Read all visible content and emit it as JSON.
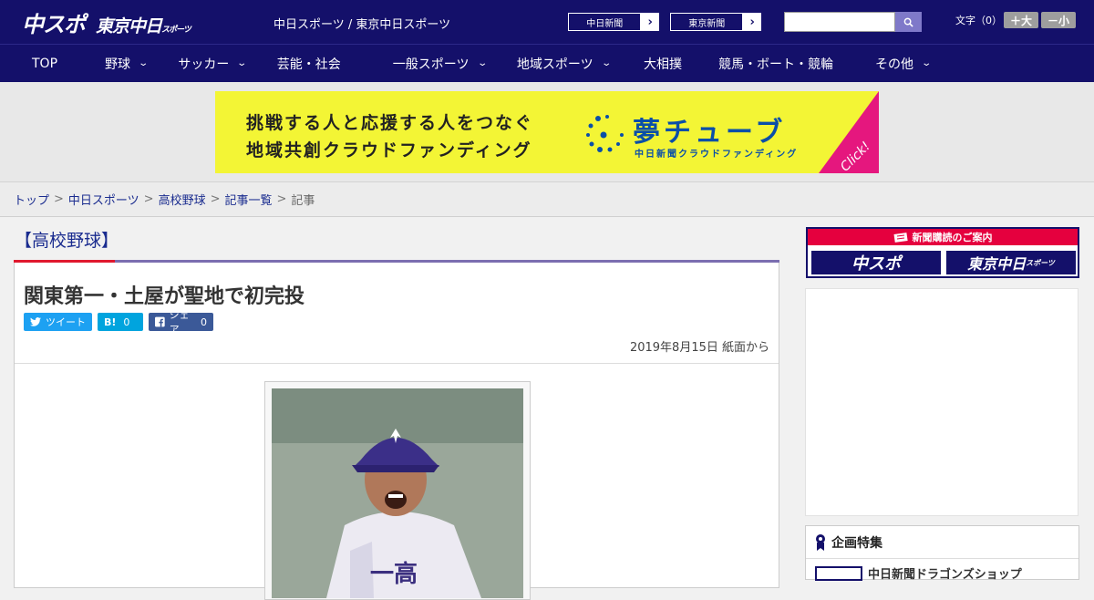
{
  "header": {
    "logo_main": "中スポ",
    "logo_tokyo": "東京中日",
    "logo_tokyo_suffix": "スポーツ",
    "site_title": "中日スポーツ / 東京中日スポーツ",
    "paper_links": [
      {
        "label": "中日新聞"
      },
      {
        "label": "東京新聞"
      }
    ],
    "search": {
      "placeholder": "",
      "value": ""
    },
    "font_size_label": "文字（0）",
    "font_bigger": "＋大",
    "font_smaller": "－小"
  },
  "nav": {
    "items": [
      {
        "label": "TOP",
        "has_dropdown": false
      },
      {
        "label": "野球",
        "has_dropdown": true
      },
      {
        "label": "サッカー",
        "has_dropdown": true
      },
      {
        "label": "芸能・社会",
        "has_dropdown": false
      },
      {
        "label": "一般スポーツ",
        "has_dropdown": true
      },
      {
        "label": "地域スポーツ",
        "has_dropdown": true
      },
      {
        "label": "大相撲",
        "has_dropdown": false
      },
      {
        "label": "競馬・ボート・競輪",
        "has_dropdown": false
      },
      {
        "label": "その他",
        "has_dropdown": true
      }
    ]
  },
  "banner": {
    "line1": "挑戦する人と応援する人をつなぐ",
    "line2": "地域共創クラウドファンディング",
    "brand": "夢チューブ",
    "brand_sub": "中日新聞クラウドファンディング",
    "click": "Click!"
  },
  "breadcrumb": {
    "items": [
      "トップ",
      "中日スポーツ",
      "高校野球",
      "記事一覧"
    ],
    "current": "記事",
    "separator": ">"
  },
  "article": {
    "category": "【高校野球】",
    "headline": "関東第一・土屋が聖地で初完投",
    "share": {
      "twitter": "ツイート",
      "hatena_label": "B!",
      "hatena_count": "0",
      "facebook": "シェア",
      "facebook_count": "0"
    },
    "date": "2019年8月15日 紙面から"
  },
  "sidebar": {
    "subscription_title": "新聞購読のご案内",
    "sub_chuspo": "中スポ",
    "sub_tokyo": "東京中日",
    "sub_tokyo_suffix": "スポーツ",
    "feature_title": "企画特集",
    "feature_item": "中日新聞ドラゴンズショップ"
  },
  "colors": {
    "brand_navy": "#14106a",
    "accent_red": "#e0182e",
    "banner_yellow": "#f3f535",
    "link_blue": "#1a2c8f"
  }
}
